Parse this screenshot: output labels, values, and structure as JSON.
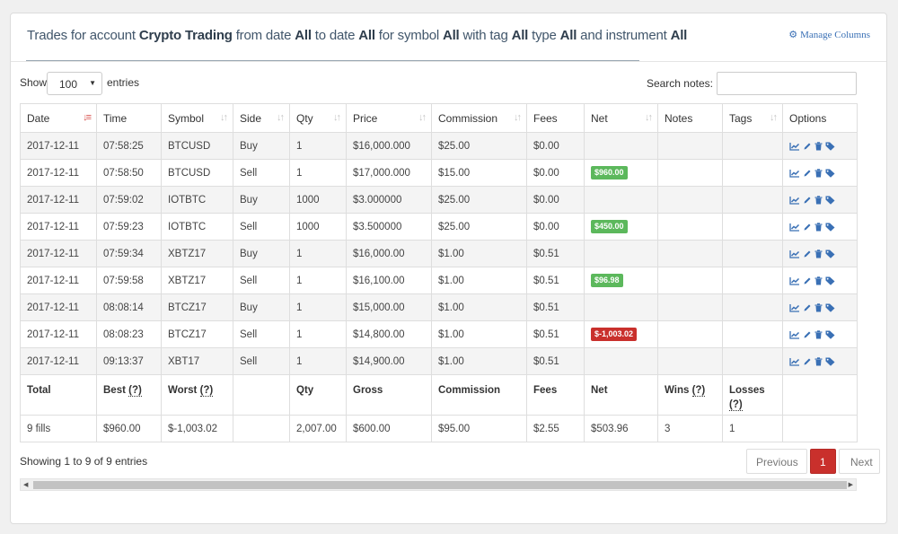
{
  "heading": {
    "p1": "Trades for account ",
    "account": "Crypto Trading",
    "p2": " from date ",
    "from": "All",
    "p3": " to date ",
    "to": "All",
    "p4": " for symbol ",
    "symbol": "All",
    "p5": " with tag ",
    "tag": "All",
    "p6": " type ",
    "type": "All",
    "p7": " and instrument ",
    "instrument": "All",
    "manage_columns": "Manage Columns"
  },
  "controls": {
    "show": "Show",
    "page_size": "100",
    "entries": "entries",
    "search_label": "Search notes:",
    "search_value": ""
  },
  "columns": [
    "Date",
    "Time",
    "Symbol",
    "Side",
    "Qty",
    "Price",
    "Commission",
    "Fees",
    "Net",
    "Notes",
    "Tags",
    "Options"
  ],
  "rows": [
    {
      "date": "2017-12-11",
      "time": "07:58:25",
      "symbol": "BTCUSD",
      "side": "Buy",
      "qty": "1",
      "price": "$16,000.000",
      "commission": "$25.00",
      "fees": "$0.00",
      "net": ""
    },
    {
      "date": "2017-12-11",
      "time": "07:58:50",
      "symbol": "BTCUSD",
      "side": "Sell",
      "qty": "1",
      "price": "$17,000.000",
      "commission": "$15.00",
      "fees": "$0.00",
      "net": "$960.00"
    },
    {
      "date": "2017-12-11",
      "time": "07:59:02",
      "symbol": "IOTBTC",
      "side": "Buy",
      "qty": "1000",
      "price": "$3.000000",
      "commission": "$25.00",
      "fees": "$0.00",
      "net": ""
    },
    {
      "date": "2017-12-11",
      "time": "07:59:23",
      "symbol": "IOTBTC",
      "side": "Sell",
      "qty": "1000",
      "price": "$3.500000",
      "commission": "$25.00",
      "fees": "$0.00",
      "net": "$450.00"
    },
    {
      "date": "2017-12-11",
      "time": "07:59:34",
      "symbol": "XBTZ17",
      "side": "Buy",
      "qty": "1",
      "price": "$16,000.00",
      "commission": "$1.00",
      "fees": "$0.51",
      "net": ""
    },
    {
      "date": "2017-12-11",
      "time": "07:59:58",
      "symbol": "XBTZ17",
      "side": "Sell",
      "qty": "1",
      "price": "$16,100.00",
      "commission": "$1.00",
      "fees": "$0.51",
      "net": "$96.98"
    },
    {
      "date": "2017-12-11",
      "time": "08:08:14",
      "symbol": "BTCZ17",
      "side": "Buy",
      "qty": "1",
      "price": "$15,000.00",
      "commission": "$1.00",
      "fees": "$0.51",
      "net": ""
    },
    {
      "date": "2017-12-11",
      "time": "08:08:23",
      "symbol": "BTCZ17",
      "side": "Sell",
      "qty": "1",
      "price": "$14,800.00",
      "commission": "$1.00",
      "fees": "$0.51",
      "net": "$-1,003.02"
    },
    {
      "date": "2017-12-11",
      "time": "09:13:37",
      "symbol": "XBT17",
      "side": "Sell",
      "qty": "1",
      "price": "$14,900.00",
      "commission": "$1.00",
      "fees": "$0.51",
      "net": ""
    }
  ],
  "totals": {
    "h_total": "Total",
    "h_best": "Best",
    "h_worst": "Worst",
    "h_qty": "Qty",
    "h_gross": "Gross",
    "h_commission": "Commission",
    "h_fees": "Fees",
    "h_net": "Net",
    "h_wins": "Wins",
    "h_losses": "Losses",
    "help": "(?)",
    "fills": "9 fills",
    "best": "$960.00",
    "worst": "$-1,003.02",
    "qty": "2,007.00",
    "gross": "$600.00",
    "commission": "$95.00",
    "fees": "$2.55",
    "net": "$503.96",
    "wins": "3",
    "losses": "1"
  },
  "footer": {
    "info": "Showing 1 to 9 of 9 entries",
    "previous": "Previous",
    "current_page": "1",
    "next": "Next"
  },
  "colors": {
    "gain": "#5cb85c",
    "loss": "#c9302c",
    "link": "#3a70b5"
  }
}
